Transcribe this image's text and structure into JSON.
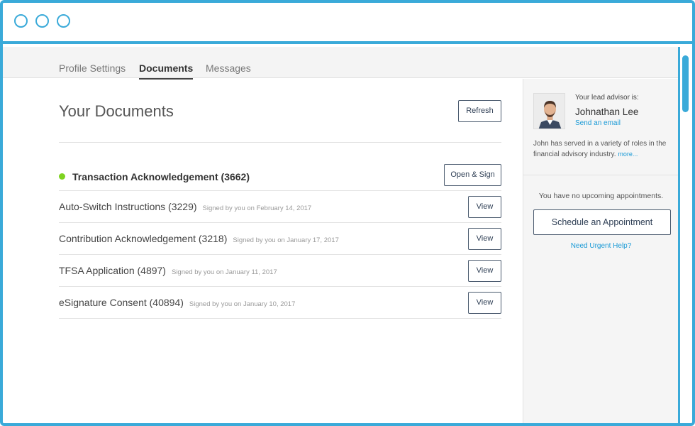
{
  "tabs": [
    {
      "label": "Profile Settings"
    },
    {
      "label": "Documents"
    },
    {
      "label": "Messages"
    }
  ],
  "page": {
    "title": "Your Documents",
    "refresh_label": "Refresh"
  },
  "pending": {
    "name": "Transaction Acknowledgement (3662)",
    "action": "Open & Sign",
    "status_color": "#7ed321"
  },
  "documents": [
    {
      "name": "Auto-Switch Instructions (3229)",
      "signed": "Signed by you on February 14, 2017",
      "action": "View"
    },
    {
      "name": "Contribution Acknowledgement (3218)",
      "signed": "Signed by you on January 17, 2017",
      "action": "View"
    },
    {
      "name": "TFSA Application (4897)",
      "signed": "Signed by you on January 11, 2017",
      "action": "View"
    },
    {
      "name": "eSignature Consent (40894)",
      "signed": "Signed by you on January 10, 2017",
      "action": "View"
    }
  ],
  "advisor": {
    "label": "Your lead advisor is:",
    "name": "Johnathan Lee",
    "email_link": "Send an email",
    "bio": "John has served in a variety of roles in the financial advisory industry.",
    "more": "more..."
  },
  "appointments": {
    "empty_text": "You have no upcoming appointments.",
    "schedule_label": "Schedule an Appointment",
    "urgent_link": "Need Urgent Help?"
  },
  "colors": {
    "accent": "#3aaad9",
    "link": "#1a9ad6",
    "button_border": "#4a5a6e"
  }
}
